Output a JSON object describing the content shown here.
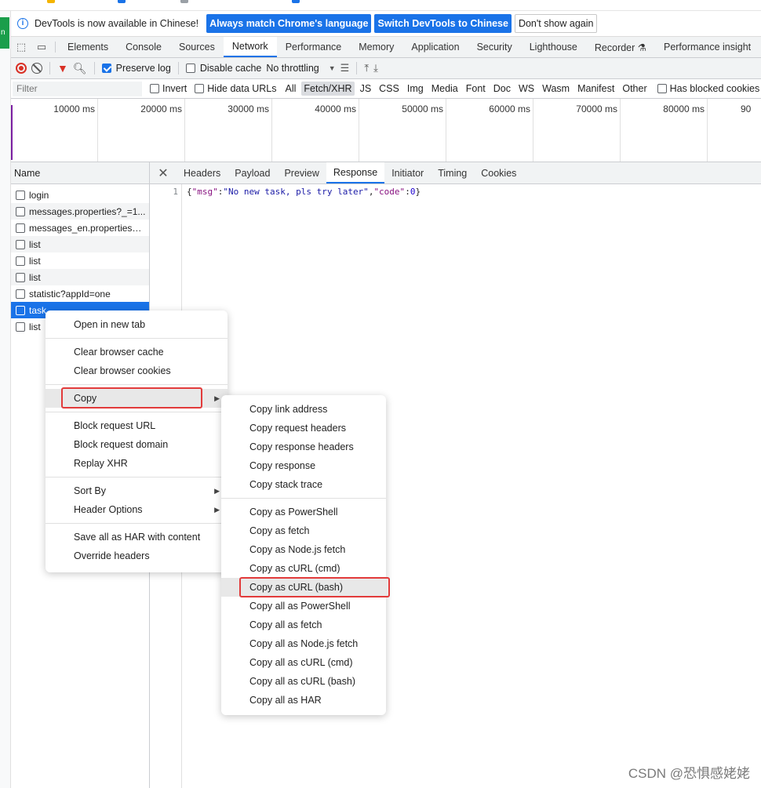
{
  "infobar": {
    "message": "DevTools is now available in Chinese!",
    "btn_match": "Always match Chrome's language",
    "btn_switch": "Switch DevTools to Chinese",
    "btn_dont_show": "Don't show again"
  },
  "panel_tabs": [
    "Elements",
    "Console",
    "Sources",
    "Network",
    "Performance",
    "Memory",
    "Application",
    "Security",
    "Lighthouse",
    "Recorder ⚗",
    "Performance insight"
  ],
  "toolbar": {
    "preserve_log": "Preserve log",
    "disable_cache": "Disable cache",
    "throttling": "No throttling"
  },
  "filter_row": {
    "placeholder": "Filter",
    "invert": "Invert",
    "hide_data_urls": "Hide data URLs",
    "types": [
      "All",
      "Fetch/XHR",
      "JS",
      "CSS",
      "Img",
      "Media",
      "Font",
      "Doc",
      "WS",
      "Wasm",
      "Manifest",
      "Other"
    ],
    "has_blocked_cookies": "Has blocked cookies"
  },
  "timeline": {
    "ticks": [
      "10000 ms",
      "20000 ms",
      "30000 ms",
      "40000 ms",
      "50000 ms",
      "60000 ms",
      "70000 ms",
      "80000 ms",
      "90"
    ]
  },
  "request_list": {
    "header": "Name",
    "rows": [
      "login",
      "messages.properties?_=1...",
      "messages_en.properties?_...",
      "list",
      "list",
      "list",
      "statistic?appId=one",
      "task",
      "list"
    ]
  },
  "details_tabs": [
    "Headers",
    "Payload",
    "Preview",
    "Response",
    "Initiator",
    "Timing",
    "Cookies"
  ],
  "response": {
    "line_number": "1",
    "key_msg": "\"msg\"",
    "val_msg": "\"No new task, pls try later\"",
    "key_code": "\"code\"",
    "val_code": "0"
  },
  "context_menu": {
    "open_new_tab": "Open in new tab",
    "clear_cache": "Clear browser cache",
    "clear_cookies": "Clear browser cookies",
    "copy": "Copy",
    "block_url": "Block request URL",
    "block_domain": "Block request domain",
    "replay_xhr": "Replay XHR",
    "sort_by": "Sort By",
    "header_options": "Header Options",
    "save_har": "Save all as HAR with content",
    "override_headers": "Override headers"
  },
  "copy_submenu": {
    "link_address": "Copy link address",
    "request_headers": "Copy request headers",
    "response_headers": "Copy response headers",
    "response": "Copy response",
    "stack_trace": "Copy stack trace",
    "as_powershell": "Copy as PowerShell",
    "as_fetch": "Copy as fetch",
    "as_node_fetch": "Copy as Node.js fetch",
    "as_curl_cmd": "Copy as cURL (cmd)",
    "as_curl_bash": "Copy as cURL (bash)",
    "all_powershell": "Copy all as PowerShell",
    "all_fetch": "Copy all as fetch",
    "all_node_fetch": "Copy all as Node.js fetch",
    "all_curl_cmd": "Copy all as cURL (cmd)",
    "all_curl_bash": "Copy all as cURL (bash)",
    "all_har": "Copy all as HAR"
  },
  "watermark": "CSDN @恐惧感姥姥",
  "colors": {
    "accent": "#1a73e8",
    "highlight_box": "#e23b3b",
    "record": "#d93025"
  }
}
